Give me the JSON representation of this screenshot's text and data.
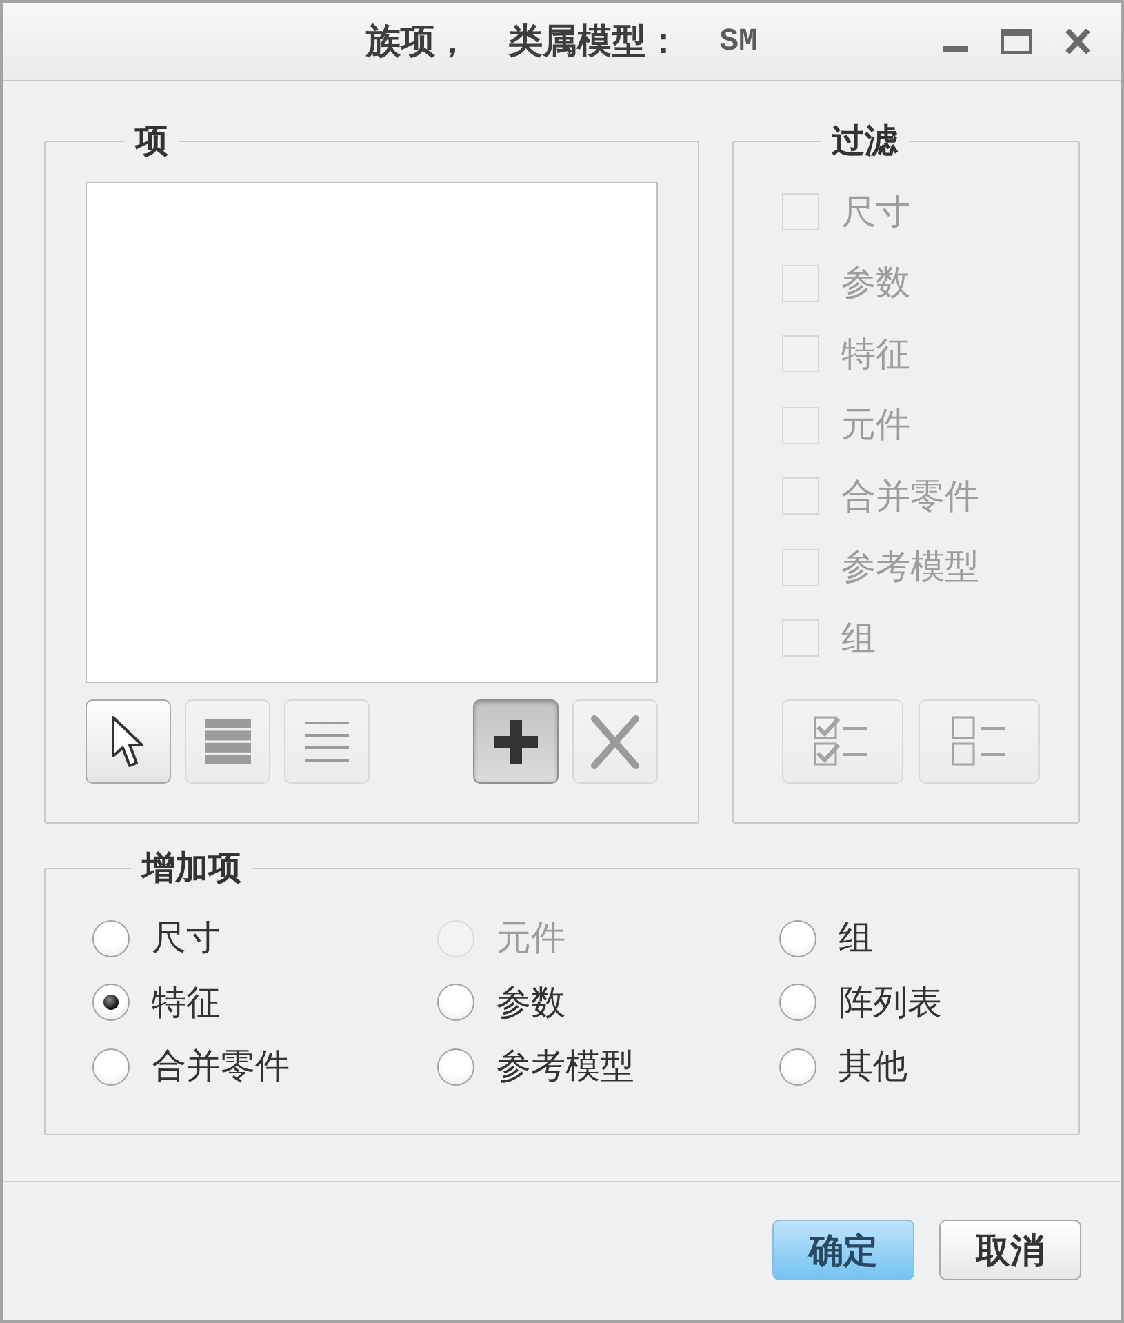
{
  "window": {
    "title": "族项，",
    "model_label": "类属模型：",
    "model_name": "SM"
  },
  "items": {
    "title": "项",
    "toolbar": [
      {
        "kind": "select",
        "disabled": false,
        "pressed": false
      },
      {
        "kind": "show_all",
        "disabled": true,
        "pressed": false
      },
      {
        "kind": "show_lines",
        "disabled": true,
        "pressed": false
      },
      {
        "kind": "add",
        "disabled": false,
        "pressed": true
      },
      {
        "kind": "remove",
        "disabled": true,
        "pressed": false
      }
    ]
  },
  "filter": {
    "title": "过滤",
    "options": [
      {
        "label": "尺寸",
        "checked": false,
        "disabled": true
      },
      {
        "label": "参数",
        "checked": false,
        "disabled": true
      },
      {
        "label": "特征",
        "checked": false,
        "disabled": true
      },
      {
        "label": "元件",
        "checked": false,
        "disabled": true
      },
      {
        "label": "合并零件",
        "checked": false,
        "disabled": true
      },
      {
        "label": "参考模型",
        "checked": false,
        "disabled": true
      },
      {
        "label": "组",
        "checked": false,
        "disabled": true
      }
    ],
    "buttons": [
      {
        "kind": "check_all",
        "disabled": true
      },
      {
        "kind": "uncheck_all",
        "disabled": true
      }
    ]
  },
  "add_items": {
    "title": "增加项",
    "options": [
      {
        "label": "尺寸",
        "selected": false,
        "disabled": false
      },
      {
        "label": "元件",
        "selected": false,
        "disabled": true
      },
      {
        "label": "组",
        "selected": false,
        "disabled": false
      },
      {
        "label": "特征",
        "selected": true,
        "disabled": false
      },
      {
        "label": "参数",
        "selected": false,
        "disabled": false
      },
      {
        "label": "阵列表",
        "selected": false,
        "disabled": false
      },
      {
        "label": "合并零件",
        "selected": false,
        "disabled": false
      },
      {
        "label": "参考模型",
        "selected": false,
        "disabled": false
      },
      {
        "label": "其他",
        "selected": false,
        "disabled": false
      }
    ]
  },
  "buttons": [
    {
      "label": "确定",
      "default": true
    },
    {
      "label": "取消",
      "default": false
    }
  ]
}
